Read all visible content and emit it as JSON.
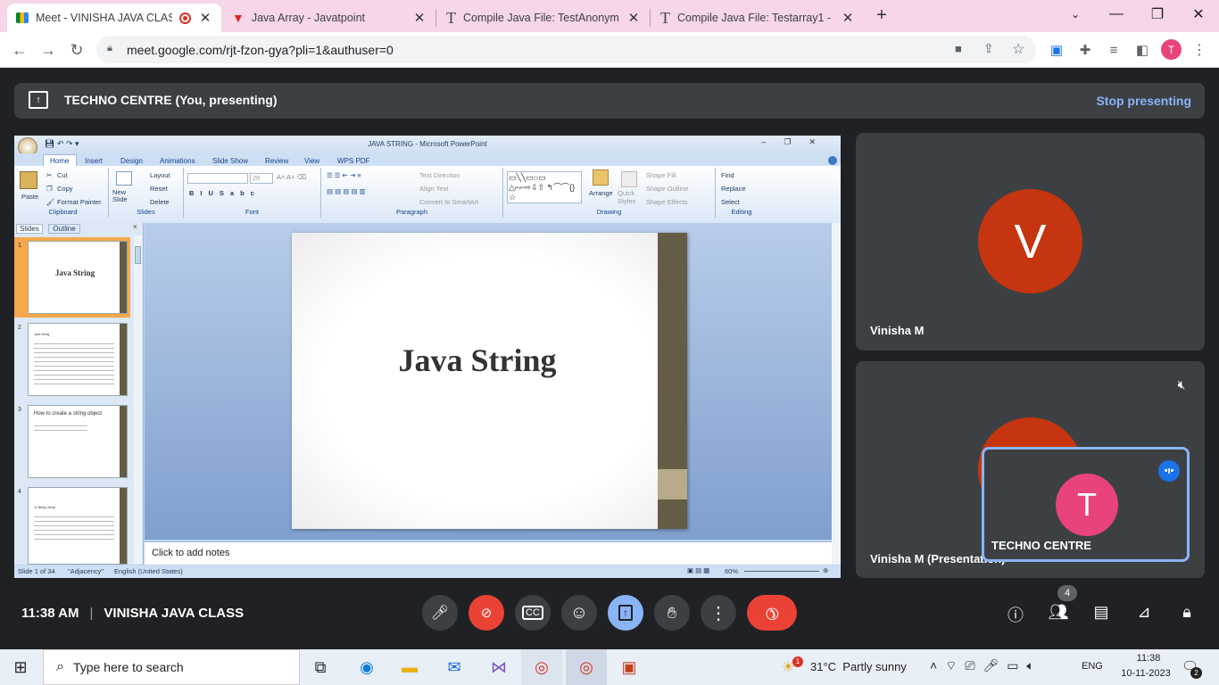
{
  "browser": {
    "tabs": [
      {
        "title": "Meet - VINISHA JAVA CLASS",
        "icon": "meet-icon"
      },
      {
        "title": "Java Array - Javatpoint",
        "icon": "javatpoint-icon"
      },
      {
        "title": "Compile Java File: TestAnonymo",
        "icon": "tutorial-icon"
      },
      {
        "title": "Compile Java File: Testarray1 - Ja",
        "icon": "tutorial-icon"
      }
    ],
    "url": "meet.google.com/rjt-fzon-gya?pli=1&authuser=0",
    "profile_initial": "T"
  },
  "presenting_bar": {
    "label": "TECHNO CENTRE (You, presenting)",
    "stop_button": "Stop presenting"
  },
  "powerpoint": {
    "window_title": "JAVA STRING - Microsoft PowerPoint",
    "ribbon_tabs": [
      "Home",
      "Insert",
      "Design",
      "Animations",
      "Slide Show",
      "Review",
      "View",
      "WPS PDF"
    ],
    "groups": {
      "clipboard": {
        "label": "Clipboard",
        "paste": "Paste",
        "cut": "Cut",
        "copy": "Copy",
        "format_painter": "Format Painter"
      },
      "slides": {
        "label": "Slides",
        "new_slide": "New Slide",
        "layout": "Layout",
        "reset": "Reset",
        "delete": "Delete"
      },
      "font": {
        "label": "Font",
        "size": "20"
      },
      "paragraph": {
        "label": "Paragraph",
        "text_direction": "Text Direction",
        "align_text": "Align Text",
        "smartart": "Convert to SmartArt"
      },
      "drawing": {
        "label": "Drawing",
        "arrange": "Arrange",
        "quick_styles": "Quick Styles",
        "shape_fill": "Shape Fill",
        "shape_outline": "Shape Outline",
        "shape_effects": "Shape Effects"
      },
      "editing": {
        "label": "Editing",
        "find": "Find",
        "replace": "Replace",
        "select": "Select"
      }
    },
    "pane_tabs": [
      "Slides",
      "Outline"
    ],
    "thumbnails": [
      {
        "num": "1",
        "title": "Java String"
      },
      {
        "num": "2",
        "title": "Java String"
      },
      {
        "num": "3",
        "title": "How to create a string object"
      },
      {
        "num": "4",
        "title": "1) String Literal"
      }
    ],
    "slide_title": "Java String",
    "notes_placeholder": "Click to add notes",
    "status": {
      "slide": "Slide 1 of 34",
      "theme": "\"Adjacency\"",
      "language": "English (United States)",
      "zoom": "60%"
    }
  },
  "participants": [
    {
      "name": "Vinisha M",
      "initial": "V",
      "color": "#c5350f"
    },
    {
      "name": "Vinisha M (Presentation)",
      "initial": "V",
      "color": "#c5350f"
    }
  ],
  "self_tile": {
    "name": "TECHNO CENTRE",
    "initial": "T",
    "color": "#e8437d"
  },
  "meeting_info": {
    "time": "11:38 AM",
    "separator": "|",
    "name": "VINISHA JAVA CLASS"
  },
  "people_count": "4",
  "taskbar": {
    "search_placeholder": "Type here to search",
    "weather_badge": "1",
    "weather": "31°C  Partly sunny",
    "language": "ENG",
    "time": "11:38",
    "date": "10-11-2023",
    "notification_count": "2"
  }
}
